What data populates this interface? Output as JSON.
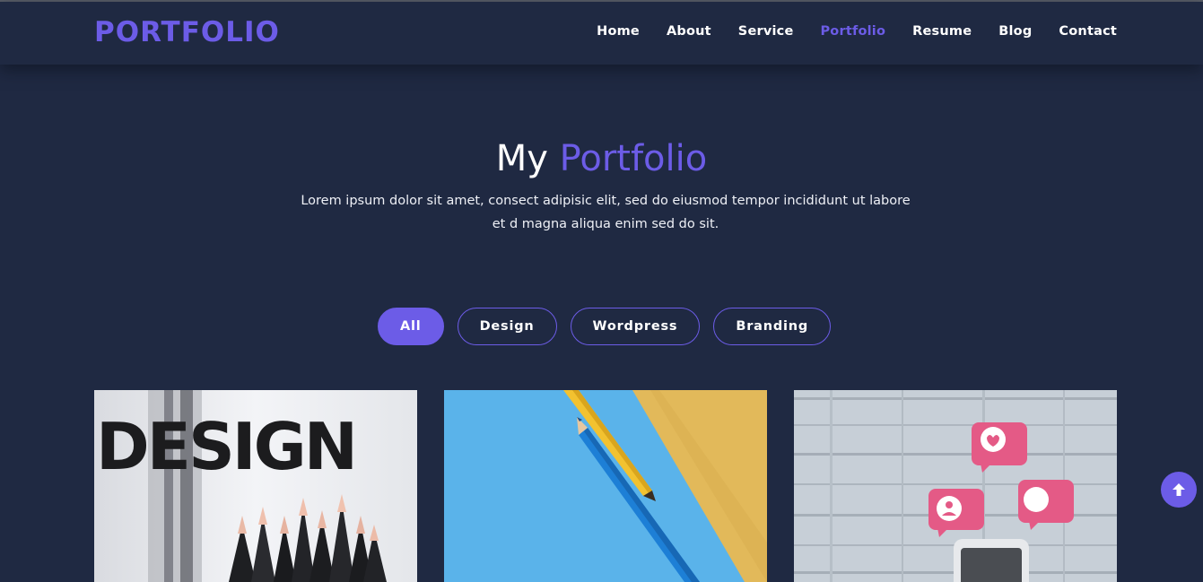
{
  "brand": {
    "logo": "PORTFOLIO",
    "accent_color": "#6c5ce7",
    "background_color": "#1f2942"
  },
  "nav": {
    "items": [
      {
        "label": "Home",
        "active": false
      },
      {
        "label": "About",
        "active": false
      },
      {
        "label": "Service",
        "active": false
      },
      {
        "label": "Portfolio",
        "active": true
      },
      {
        "label": "Resume",
        "active": false
      },
      {
        "label": "Blog",
        "active": false
      },
      {
        "label": "Contact",
        "active": false
      }
    ]
  },
  "hero": {
    "title_prefix": "My",
    "title_highlight": "Portfolio",
    "description": "Lorem ipsum dolor sit amet, consect adipisic elit, sed do eiusmod tempor incididunt ut labore et d magna aliqua enim sed do sit."
  },
  "filters": {
    "items": [
      {
        "label": "All",
        "active": true
      },
      {
        "label": "Design",
        "active": false
      },
      {
        "label": "Wordpress",
        "active": false
      },
      {
        "label": "Branding",
        "active": false
      }
    ]
  },
  "portfolio": {
    "items": [
      {
        "image": "design-word-and-black-pencils",
        "printed_text": "DESIGN"
      },
      {
        "image": "blue-and-yellow-pencils-on-blue-and-yellow-paper"
      },
      {
        "image": "social-media-like-icons-with-phone-on-wood"
      }
    ]
  },
  "scroll_top": {
    "icon": "arrow-up-icon"
  }
}
